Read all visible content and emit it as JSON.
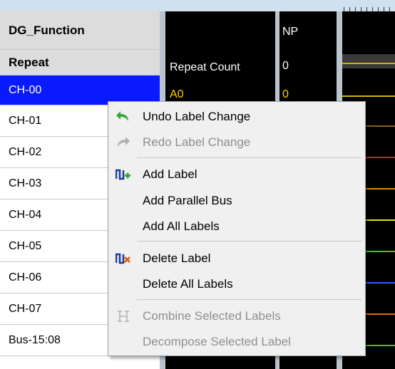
{
  "name_column": {
    "header": "DG_Function",
    "group": "Repeat",
    "rows": [
      "CH-00",
      "CH-01",
      "CH-02",
      "CH-03",
      "CH-04",
      "CH-05",
      "CH-06",
      "CH-07",
      "Bus-15:08"
    ]
  },
  "value_column": {
    "repeat_label": "Repeat Count",
    "ch00_label": "A0"
  },
  "param_column": {
    "header": "NP",
    "repeat_value": "0",
    "ch00_value": "0"
  },
  "context_menu": {
    "undo": "Undo Label Change",
    "redo": "Redo Label Change",
    "add_label": "Add Label",
    "add_parallel_bus": "Add Parallel Bus",
    "add_all_labels": "Add All Labels",
    "delete_label": "Delete Label",
    "delete_all_labels": "Delete All Labels",
    "combine": "Combine Selected Labels",
    "decompose": "Decompose Selected Label"
  },
  "colors": {
    "selection": "#0a1aff",
    "value_yellow": "#ffd200",
    "disabled_text": "#8f8f8f"
  },
  "icons": [
    "undo-icon",
    "redo-icon",
    "add-label-icon",
    "delete-label-icon",
    "combine-icon"
  ]
}
